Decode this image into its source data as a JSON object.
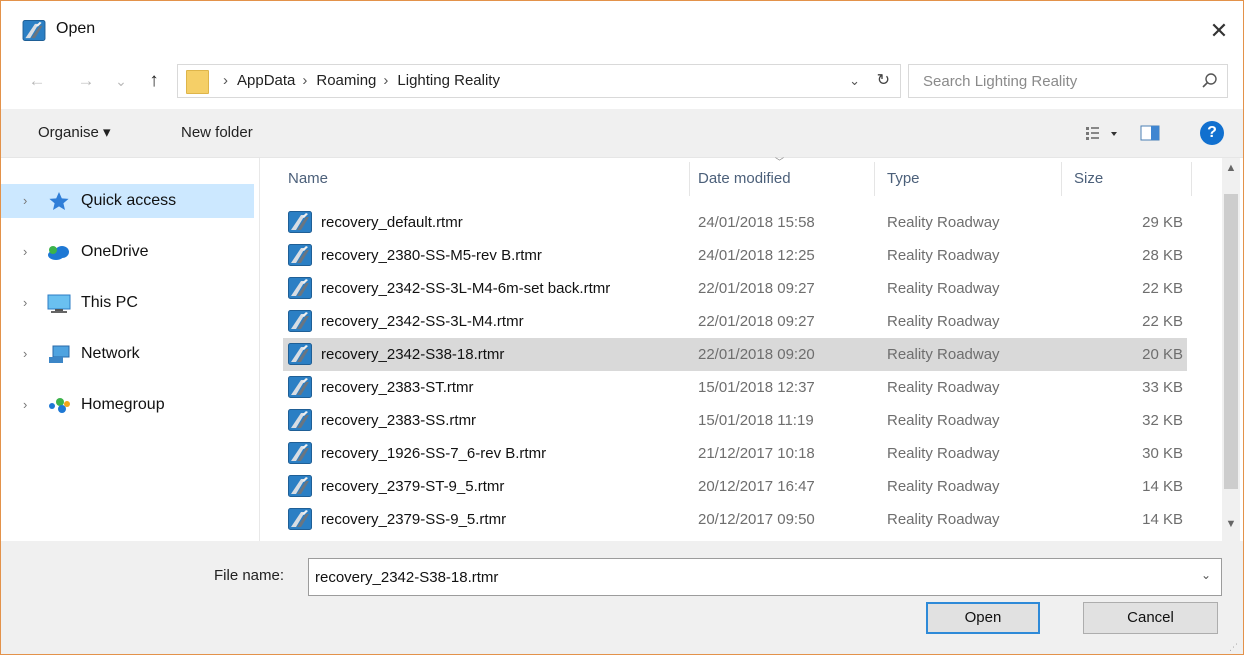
{
  "window": {
    "title": "Open",
    "close_glyph": "✕",
    "icon": "lighting-reality-app-icon"
  },
  "nav": {
    "back_glyph": "←",
    "forward_glyph": "→",
    "recent_glyph": "⌄",
    "up_glyph": "↑",
    "breadcrumbs": [
      "AppData",
      "Roaming",
      "Lighting Reality"
    ],
    "dropdown_glyph": "⌄",
    "refresh_glyph": "↻",
    "search_placeholder": "Search Lighting Reality"
  },
  "toolbar": {
    "organise_label": "Organise ▾",
    "new_folder_label": "New folder",
    "help_glyph": "?"
  },
  "sidebar": {
    "items": [
      {
        "label": "Quick access",
        "icon": "star-icon",
        "active": true
      },
      {
        "label": "OneDrive",
        "icon": "cloud-icon",
        "active": false
      },
      {
        "label": "This PC",
        "icon": "monitor-icon",
        "active": false
      },
      {
        "label": "Network",
        "icon": "network-icon",
        "active": false
      },
      {
        "label": "Homegroup",
        "icon": "homegroup-icon",
        "active": false
      }
    ]
  },
  "filelist": {
    "columns": {
      "name": "Name",
      "date": "Date modified",
      "type": "Type",
      "size": "Size"
    },
    "sort_glyph": "﹀",
    "rows": [
      {
        "name": "recovery_default.rtmr",
        "date": "24/01/2018 15:58",
        "type": "Reality Roadway",
        "size": "29 KB",
        "selected": false
      },
      {
        "name": "recovery_2380-SS-M5-rev B.rtmr",
        "date": "24/01/2018 12:25",
        "type": "Reality Roadway",
        "size": "28 KB",
        "selected": false
      },
      {
        "name": "recovery_2342-SS-3L-M4-6m-set back.rtmr",
        "date": "22/01/2018 09:27",
        "type": "Reality Roadway",
        "size": "22 KB",
        "selected": false
      },
      {
        "name": "recovery_2342-SS-3L-M4.rtmr",
        "date": "22/01/2018 09:27",
        "type": "Reality Roadway",
        "size": "22 KB",
        "selected": false
      },
      {
        "name": "recovery_2342-S38-18.rtmr",
        "date": "22/01/2018 09:20",
        "type": "Reality Roadway",
        "size": "20 KB",
        "selected": true
      },
      {
        "name": "recovery_2383-ST.rtmr",
        "date": "15/01/2018 12:37",
        "type": "Reality Roadway",
        "size": "33 KB",
        "selected": false
      },
      {
        "name": "recovery_2383-SS.rtmr",
        "date": "15/01/2018 11:19",
        "type": "Reality Roadway",
        "size": "32 KB",
        "selected": false
      },
      {
        "name": "recovery_1926-SS-7_6-rev B.rtmr",
        "date": "21/12/2017 10:18",
        "type": "Reality Roadway",
        "size": "30 KB",
        "selected": false
      },
      {
        "name": "recovery_2379-ST-9_5.rtmr",
        "date": "20/12/2017 16:47",
        "type": "Reality Roadway",
        "size": "14 KB",
        "selected": false
      },
      {
        "name": "recovery_2379-SS-9_5.rtmr",
        "date": "20/12/2017 09:50",
        "type": "Reality Roadway",
        "size": "14 KB",
        "selected": false
      }
    ],
    "scroll_up_glyph": "▲",
    "scroll_down_glyph": "▼"
  },
  "footer": {
    "file_name_label": "File name:",
    "file_name_value": "recovery_2342-S38-18.rtmr",
    "dropdown_glyph": "⌄",
    "open_label": "Open",
    "cancel_label": "Cancel"
  },
  "colors": {
    "accent": "#2e8ad8",
    "selected_row": "#d9d9d9",
    "active_nav": "#cce8ff",
    "border_accent": "#e3924a"
  }
}
